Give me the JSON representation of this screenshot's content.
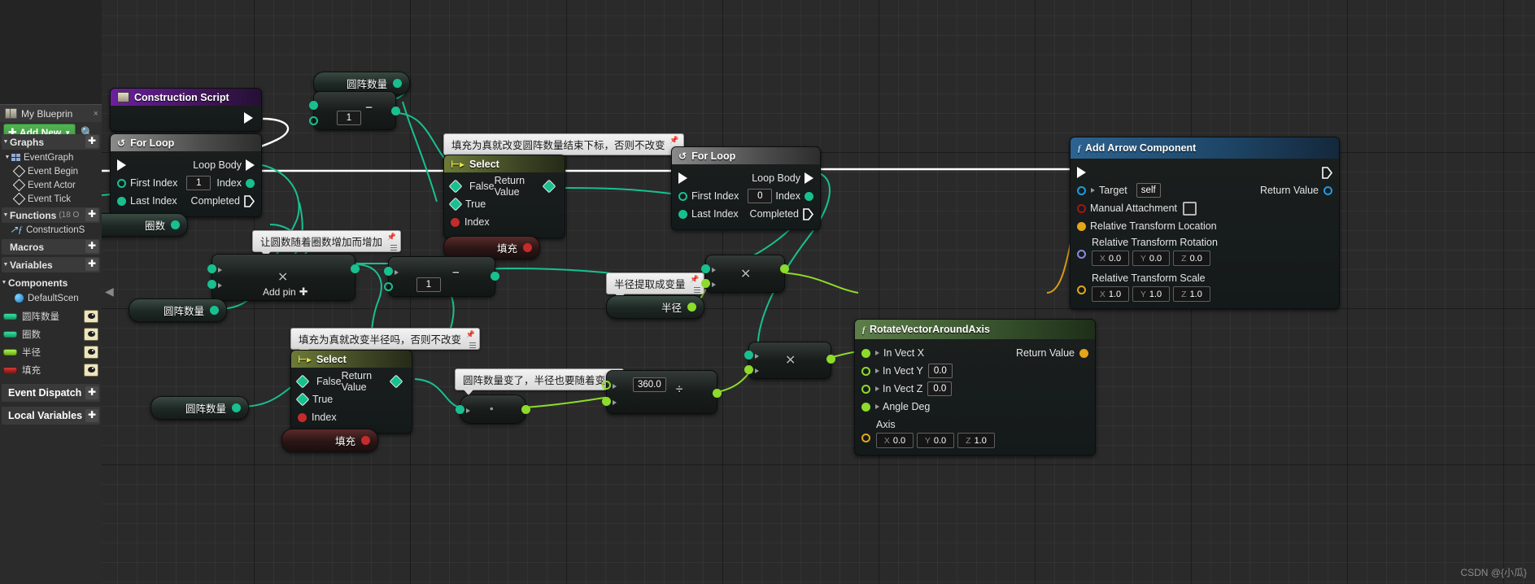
{
  "app": {
    "watermark": "CSDN @{小瓜}"
  },
  "sidebar": {
    "tab": {
      "label": "My Blueprin",
      "icon": "book-icon",
      "close": "×"
    },
    "toolbar": {
      "add_new_label": "Add New",
      "add_new_plus": "✚",
      "add_new_caret": "▼",
      "search_icon": "search-icon"
    },
    "sections": [
      {
        "label": "Graphs",
        "plus": "✚",
        "count": ""
      },
      {
        "label": "Functions",
        "plus": "✚",
        "count": "(18 O"
      },
      {
        "label": "Macros",
        "plus": "✚",
        "count": ""
      },
      {
        "label": "Variables",
        "plus": "✚",
        "count": ""
      },
      {
        "label": "Components",
        "plus": "",
        "count": ""
      }
    ],
    "event_graph": {
      "label": "EventGraph",
      "icon": "graph-icon"
    },
    "events": [
      {
        "label": "Event Begin",
        "icon": "event-node-icon"
      },
      {
        "label": "Event Actor",
        "icon": "event-node-icon"
      },
      {
        "label": "Event Tick",
        "icon": "event-node-icon"
      }
    ],
    "functions": [
      {
        "label": "ConstructionS",
        "icon": "function-icon"
      }
    ],
    "components": [
      {
        "label": "DefaultScen",
        "icon": "scene-component-icon"
      }
    ],
    "variables": [
      {
        "label": "圆阵数量",
        "color": "#1fb37a",
        "eye": "eye-icon"
      },
      {
        "label": "圈数",
        "color": "#1fb37a",
        "eye": "eye-icon"
      },
      {
        "label": "半径",
        "color": "#8ddb2a",
        "eye": "eye-icon"
      },
      {
        "label": "填充",
        "color": "#b5201f",
        "eye": "eye-icon"
      }
    ],
    "buttons": [
      {
        "label": "Event Dispatch",
        "plus": "✚"
      },
      {
        "label": "Local Variables",
        "plus": "✚"
      }
    ]
  },
  "graph": {
    "nodes": {
      "construction_script": {
        "title": "Construction Script",
        "icon": "construction-script-icon"
      },
      "for_loop_1": {
        "title": "For Loop",
        "icon": "loop-icon",
        "first_index_label": "First Index",
        "first_index_value": "1",
        "last_index_label": "Last Index",
        "loop_body_label": "Loop Body",
        "index_label": "Index",
        "completed_label": "Completed"
      },
      "for_loop_2": {
        "title": "For Loop",
        "icon": "loop-icon",
        "first_index_label": "First Index",
        "first_index_value": "0",
        "last_index_label": "Last Index",
        "loop_body_label": "Loop Body",
        "index_label": "Index",
        "completed_label": "Completed"
      },
      "select_top": {
        "title": "Select",
        "icon": "select-icon",
        "false_label": "False",
        "true_label": "True",
        "index_label": "Index",
        "return_label": "Return Value"
      },
      "select_bottom": {
        "title": "Select",
        "icon": "select-icon",
        "false_label": "False",
        "true_label": "True",
        "index_label": "Index",
        "return_label": "Return Value"
      },
      "rotate_vector": {
        "title": "RotateVectorAroundAxis",
        "icon": "function-icon",
        "in_vect_x": "In Vect X",
        "in_vect_y": "In Vect Y",
        "in_vect_y_value": "0.0",
        "in_vect_z": "In Vect Z",
        "in_vect_z_value": "0.0",
        "angle_deg": "Angle Deg",
        "axis_label": "Axis",
        "axis_x": "0.0",
        "axis_y": "0.0",
        "axis_z": "1.0",
        "return_label": "Return Value"
      },
      "add_arrow": {
        "title": "Add Arrow Component",
        "icon": "function-icon",
        "target_label": "Target",
        "target_value": "self",
        "manual_attachment_label": "Manual Attachment",
        "rel_location_label": "Relative Transform Location",
        "rel_rotation_label": "Relative Transform Rotation",
        "rot_x": "0.0",
        "rot_y": "0.0",
        "rot_z": "0.0",
        "rel_scale_label": "Relative Transform Scale",
        "scale_x": "1.0",
        "scale_y": "1.0",
        "scale_z": "1.0",
        "return_label": "Return Value"
      },
      "subtract_top": {
        "symbol": "−",
        "operand": "1"
      },
      "subtract_mid": {
        "symbol": "−",
        "operand": "1"
      },
      "multiply_main": {
        "symbol": "✕",
        "add_pin_label": "Add pin",
        "add_pin_plus": "✚"
      },
      "multiply_a": {
        "symbol": "✕"
      },
      "multiply_b": {
        "symbol": "✕"
      },
      "divide": {
        "symbol": "÷",
        "operand": "360.0"
      },
      "float_conv": {
        "symbol": "•"
      }
    },
    "var_getters": [
      {
        "id": "round_count_top",
        "label": "圆阵数量",
        "color": "#1fb37a"
      },
      {
        "id": "ring_count",
        "label": "圈数",
        "color": "#1fb37a"
      },
      {
        "id": "round_count_mid",
        "label": "圆阵数量",
        "color": "#1fb37a"
      },
      {
        "id": "round_count_bottom",
        "label": "圆阵数量",
        "color": "#1fb37a"
      },
      {
        "id": "radius",
        "label": "半径",
        "color": "#8ddb2a"
      },
      {
        "id": "fill_top",
        "label": "填充",
        "color": "#c42b2b"
      },
      {
        "id": "fill_bottom",
        "label": "填充",
        "color": "#c42b2b"
      }
    ],
    "comments": [
      {
        "id": "comment-fill-count",
        "text": "填充为真就改变圆阵数量结束下标，否则不改变"
      },
      {
        "id": "comment-ring-grow",
        "text": "让圆数随着圈数增加而增加"
      },
      {
        "id": "comment-fill-radius",
        "text": "填充为真就改变半径吗，否则不改变"
      },
      {
        "id": "comment-radius-var",
        "text": "半径提取成变量"
      },
      {
        "id": "comment-count-radius",
        "text": "圆阵数量变了，半径也要随着变"
      }
    ]
  }
}
